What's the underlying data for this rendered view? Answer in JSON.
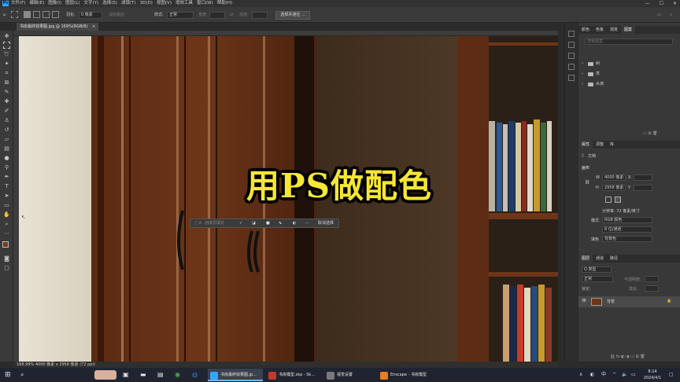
{
  "app": {
    "logo": "Ps"
  },
  "menu": {
    "items": [
      "文件(F)",
      "编辑(E)",
      "图像(I)",
      "图层(L)",
      "文字(Y)",
      "选择(S)",
      "滤镜(T)",
      "3D(D)",
      "视图(V)",
      "增效工具",
      "窗口(W)",
      "帮助(H)"
    ]
  },
  "window_controls": {
    "minimize": "—",
    "maximize": "☐",
    "close": "✕"
  },
  "options": {
    "feather_label": "羽化:",
    "feather_value": "0 像素",
    "antialias_label": "消除锯齿",
    "style_label": "样式:",
    "style_value": "正常",
    "width_label": "宽度:",
    "height_label": "高度:",
    "select_mask_button": "选择并遮住 ..."
  },
  "document": {
    "tab_title": "书房最终效果图.jpg @ 169%(RGB/8)",
    "tab_close": "×",
    "overlay_title": "用PS做配色",
    "status": "168.99%   4000 像素 x 2958 像素 (72 ppi)"
  },
  "context_bar": {
    "placeholder": "创成式填充",
    "cancel_label": "取消选择"
  },
  "top_panel": {
    "tabs": [
      "颜色",
      "色板",
      "渐变",
      "图案"
    ],
    "active_tab": "图案",
    "search_placeholder": "搜索图案",
    "groups": [
      "树",
      "草",
      "水滴"
    ]
  },
  "properties": {
    "tabs": [
      "属性",
      "调整",
      "库"
    ],
    "doc_label": "文档",
    "canvas_header": "画布",
    "w_label": "W",
    "w_value": "4000 像素",
    "x_label": "X",
    "h_label": "H",
    "h_value": "2958 像素",
    "y_label": "Y",
    "resolution": "分辨率: 72 像素/英寸",
    "mode_label": "模式",
    "mode_value": "RGB 颜色",
    "depth_value": "8 位/通道",
    "bg_label": "填色",
    "bg_value": "背景色"
  },
  "layers": {
    "tabs": [
      "图层",
      "通道",
      "路径"
    ],
    "search_placeholder": "Q 类型",
    "blend_mode": "正常",
    "opacity_label": "不透明度:",
    "lock_label": "锁定:",
    "fill_label": "填充:",
    "layer_name": "背景"
  },
  "taskbar": {
    "search_icon": "search-icon",
    "items": [
      {
        "label": "书房最终效果图.jp...",
        "active": true,
        "color": "#31a8ff"
      },
      {
        "label": "书房模型.skp - Sk...",
        "active": false,
        "color": "#c0392b"
      },
      {
        "label": "视觉设置",
        "active": false,
        "color": "#7a7a7a"
      },
      {
        "label": "Enscape - 书房模型",
        "active": false,
        "color": "#e67e22"
      }
    ],
    "time": "8:14",
    "date": "2024/4/1"
  },
  "colors": {
    "accent": "#31a8ff",
    "overlay_text": "#f7e634",
    "panel_bg": "#383838"
  }
}
